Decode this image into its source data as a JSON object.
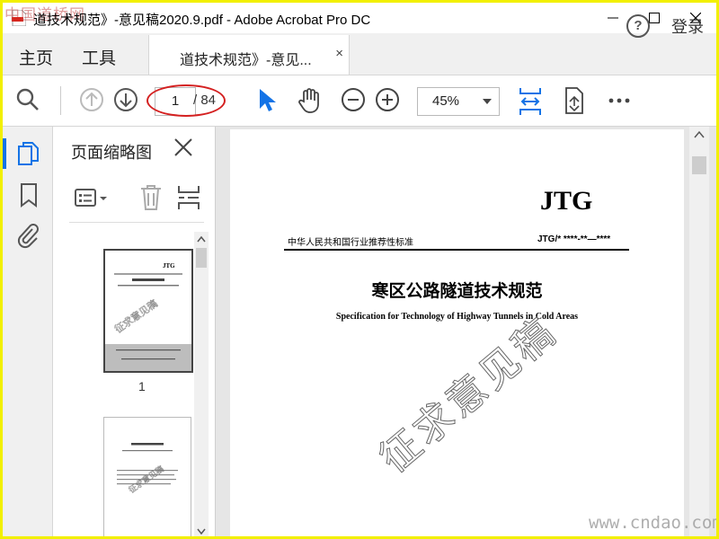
{
  "window": {
    "title": "道技术规范》-意见稿2020.9.pdf - Adobe Acrobat Pro DC",
    "watermark_logo": "中国道桥网"
  },
  "menu": {
    "home": "主页",
    "tools": "工具",
    "doc_tab": "道技术规范》-意见...",
    "doc_tab_close": "×",
    "help": "?",
    "login": "登录"
  },
  "toolbar": {
    "page_current": "1",
    "page_total": "/ 84",
    "zoom": "45%"
  },
  "thumbnails": {
    "title": "页面缩略图",
    "page_numbers": [
      "1"
    ]
  },
  "document": {
    "mark": "JTG",
    "standard_category": "中华人民共和国行业推荐性标准",
    "code": "JTG/* ****-**—****",
    "title": "寒区公路隧道技术规范",
    "subtitle": "Specification for Technology of Highway Tunnels in Cold Areas",
    "stamp": "征求意见稿"
  },
  "site_watermark": "www.cndao.com",
  "colors": {
    "accent": "#1473e6",
    "highlight": "#d42020",
    "outer_frame": "#f2f000"
  }
}
